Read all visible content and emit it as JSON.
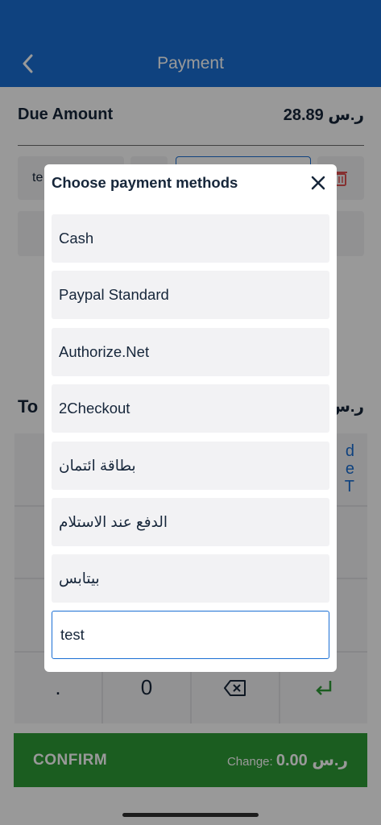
{
  "header": {
    "title": "Payment",
    "back_icon": "chevron-left-icon"
  },
  "payment": {
    "due_label": "Due Amount",
    "due_value": "28.89 ر.س",
    "line_name": "te",
    "total_label": "To",
    "total_value": "ر.س"
  },
  "keypad": {
    "side_line1": "d",
    "side_line2": "e",
    "side_line3": "T",
    "dot": ".",
    "zero": "0",
    "backspace_icon": "backspace-icon",
    "enter_icon": "enter-icon"
  },
  "confirm": {
    "label": "CONFIRM",
    "change_label": "Change: ",
    "change_value": "0.00 ر.س"
  },
  "modal": {
    "title": "Choose payment methods",
    "close_icon": "close-icon",
    "methods": [
      "Cash",
      "Paypal Standard",
      "Authorize.Net",
      "2Checkout",
      "بطاقة ائتمان",
      "الدفع عند الاستلام",
      "بيتابس",
      "test"
    ],
    "selected_index": 7
  },
  "colors": {
    "primary": "#1a6fd4",
    "confirm": "#2e9b36",
    "danger": "#e05050"
  }
}
